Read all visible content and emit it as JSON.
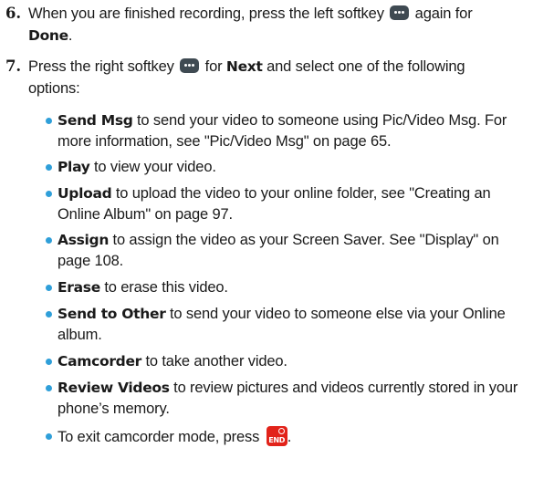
{
  "steps": [
    {
      "number": "6.",
      "line1_pre": "When you are finished recording, press the left softkey",
      "line1_post": "again for",
      "bold": "Done",
      "tail": "."
    },
    {
      "number": "7.",
      "pre": "Press the right softkey",
      "bold": "Next",
      "post": "and select one of the following",
      "line2": "options:"
    }
  ],
  "bullets": [
    {
      "bold": "Send Msg",
      "line1": "to send your video to someone using Pic/Video Msg. For",
      "line2": "more information, see \"Pic/Video Msg\" on page 65."
    },
    {
      "bold": "Play",
      "line1": "to view your video."
    },
    {
      "bold": "Upload",
      "line1": "to upload the video to your online folder, see \"Creating an",
      "line2": "Online Album\" on page 97."
    },
    {
      "bold": "Assign",
      "line1": "to assign the video as your Screen Saver. See \"Display\" on",
      "line2": "page 108."
    },
    {
      "bold": "Erase",
      "line1": "to erase this video."
    },
    {
      "bold": "Send to Other",
      "line1": "to send your video to someone else via your Online",
      "line2": "album."
    },
    {
      "bold": "Camcorder",
      "line1": "to take another video."
    },
    {
      "bold": "Review Videos",
      "line1": "to review pictures and videos currently stored in your",
      "line2": "phone’s memory."
    }
  ],
  "exit": {
    "text": "To exit camcorder mode, press",
    "end_key_label": "END",
    "tail": "."
  },
  "icons": {
    "softkey": "softkey-icon",
    "end_key": "end-key-icon",
    "bullet_color": "#2f9fd9",
    "end_key_color": "#e2231a"
  }
}
